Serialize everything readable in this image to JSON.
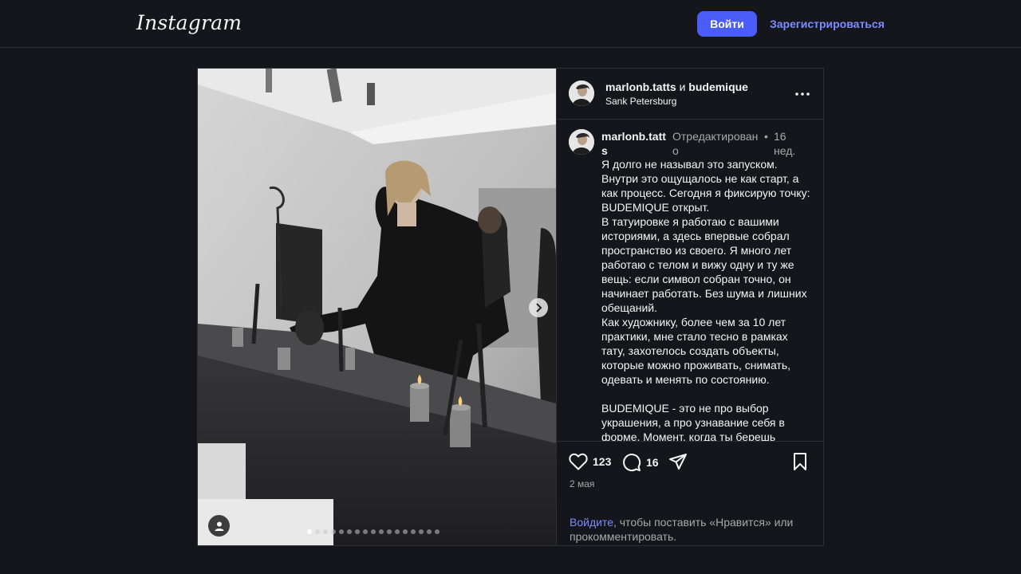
{
  "header": {
    "logo": "Instagram",
    "login_button": "Войти",
    "signup_link": "Зарегистрироваться"
  },
  "post": {
    "author_1": "marlonb.tatts",
    "conjunction": "и",
    "author_2": "budemique",
    "location": "Sank Petersburg",
    "caption_user": "marlonb.tatts",
    "edited_label": "Отредактировано",
    "separator": "•",
    "time_ago": "16 нед.",
    "caption_text": "Я долго не называл это запуском. Внутри это ощущалось не как старт, а как процесс. Сегодня я фиксирую точку: BUDEMIQUE открыт.\nВ татуировке я работаю с вашими историями, а здесь впервые собрал пространство из своего. Я много лет работаю с телом и вижу одну и ту же вещь: если символ собран точно, он начинает работать. Без шума и лишних обещаний.\nКак художнику, более чем за 10 лет практики, мне стало тесно в рамках тату, захотелось создать объекты, которые можно проживать, снимать, одевать и менять по состоянию.\n\nBUDEMIQUE - это не про выбор украшения, а про узнавание себя в форме. Момент, когда ты берешь",
    "likes": "123",
    "comments": "16",
    "date": "2 мая",
    "login_prompt_link": "Войдите",
    "login_prompt_text": ", чтобы поставить «Нравится» или прокомментировать.",
    "carousel_count": 17,
    "carousel_active": 1
  },
  "icons": {
    "next": "chevron-right-icon",
    "more": "more-horizontal-icon",
    "like": "heart-icon",
    "comment": "comment-icon",
    "share": "share-icon",
    "save": "bookmark-icon",
    "user_tag": "user-tag-icon"
  },
  "colors": {
    "background": "#15161b",
    "accent": "#4a5df9",
    "link": "#7c8cff",
    "muted": "#a8a8a8"
  }
}
